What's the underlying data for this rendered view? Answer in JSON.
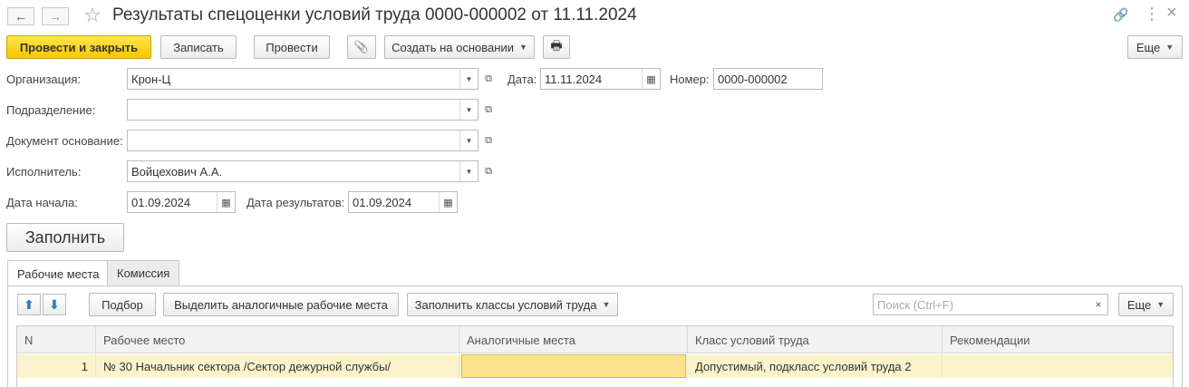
{
  "window": {
    "title": "Результаты спецоценки условий труда 0000-000002 от 11.11.2024",
    "back_icon": "←",
    "forward_icon": "→",
    "star_icon": "☆",
    "link_icon": "🔗",
    "more_icon": "⋮",
    "close_icon": "×"
  },
  "toolbar": {
    "post_close": "Провести и закрыть",
    "save": "Записать",
    "post": "Провести",
    "attach_icon": "📎",
    "create_based": "Создать на основании",
    "print_icon": "🖶",
    "more": "Еще"
  },
  "form": {
    "org_label": "Организация:",
    "org_value": "Крон-Ц",
    "date_label": "Дата:",
    "date_value": "11.11.2024",
    "number_label": "Номер:",
    "number_value": "0000-000002",
    "division_label": "Подразделение:",
    "division_value": "",
    "base_doc_label": "Документ основание:",
    "base_doc_value": "",
    "executor_label": "Исполнитель:",
    "executor_value": "Войцехович А.А.",
    "start_date_label": "Дата начала:",
    "start_date_value": "01.09.2024",
    "result_date_label": "Дата результатов:",
    "result_date_value": "01.09.2024",
    "fill_button": "Заполнить"
  },
  "tabs": [
    {
      "label": "Рабочие места"
    },
    {
      "label": "Комиссия"
    }
  ],
  "table_toolbar": {
    "up_icon": "⬆",
    "down_icon": "⬇",
    "select": "Подбор",
    "highlight_similar": "Выделить аналогичные рабочие места",
    "fill_classes": "Заполнить классы условий труда",
    "search_placeholder": "Поиск (Ctrl+F)",
    "clear": "×",
    "more": "Еще"
  },
  "table": {
    "columns": [
      "N",
      "Рабочее место",
      "Аналогичные места",
      "Класс условий труда",
      "Рекомендации"
    ],
    "rows": [
      {
        "n": "1",
        "workplace": "№ 30 Начальник сектора /Сектор дежурной службы/",
        "similar": "",
        "class": "Допустимый, подкласс условий труда 2",
        "recommendations": ""
      }
    ]
  },
  "colors": {
    "primary_button": "#f5c800",
    "selected_row": "#fbf3cc",
    "edit_cell": "#fbe38d"
  }
}
